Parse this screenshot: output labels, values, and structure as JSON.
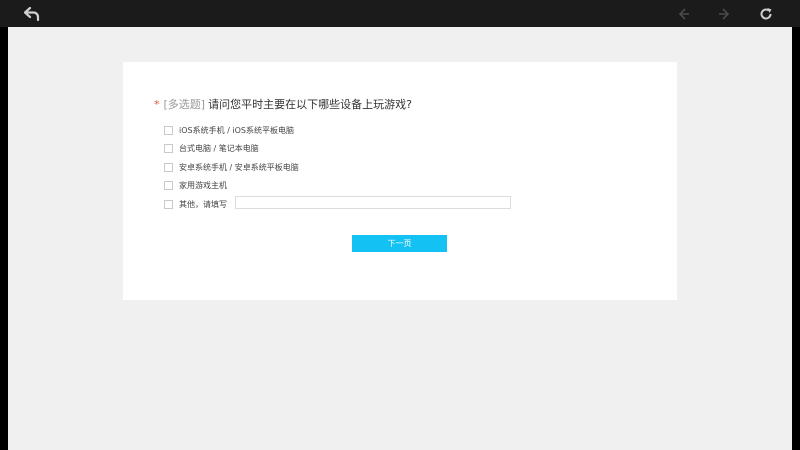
{
  "toolbar": {
    "back_icon": "back-arrow-icon",
    "prev_icon": "chevron-left-icon",
    "next_icon": "chevron-right-icon",
    "refresh_icon": "refresh-icon"
  },
  "question": {
    "required_mark": "*",
    "type_tag": "[多选题]",
    "text": "请问您平时主要在以下哪些设备上玩游戏?"
  },
  "options": [
    {
      "label": "iOS系统手机 / iOS系统平板电脑"
    },
    {
      "label": "台式电脑 / 笔记本电脑"
    },
    {
      "label": "安卓系统手机 / 安卓系统平板电脑"
    },
    {
      "label": "家用游戏主机"
    },
    {
      "label": "其他，请填写"
    }
  ],
  "other_input": {
    "value": "",
    "placeholder": ""
  },
  "next_button": {
    "label": "下一页"
  },
  "colors": {
    "topbar": "#1b1b1b",
    "background": "#f0f0f0",
    "card": "#ffffff",
    "accent": "#13c1f2",
    "required": "#e8563f"
  }
}
